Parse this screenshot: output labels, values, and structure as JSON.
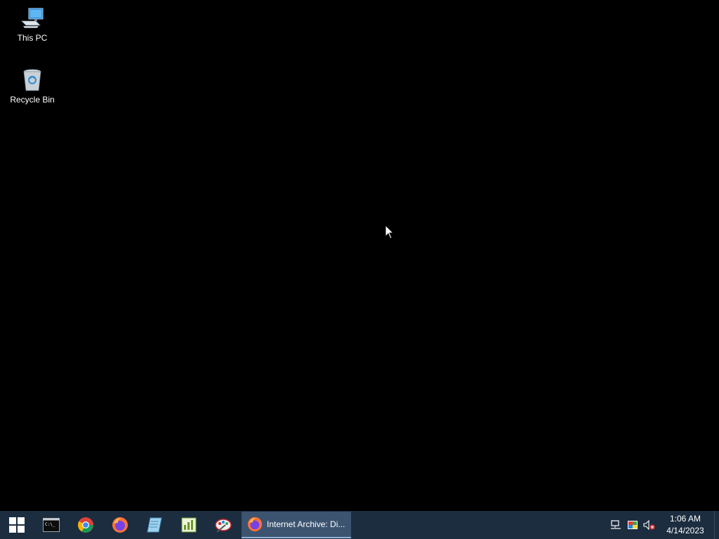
{
  "desktop": {
    "icons": [
      {
        "label": "This PC",
        "icon": "computer-icon"
      },
      {
        "label": "Recycle Bin",
        "icon": "recycle-bin-icon"
      }
    ]
  },
  "taskbar": {
    "start_icon": "windows-logo-icon",
    "pinned": [
      {
        "name": "command-prompt",
        "icon": "terminal-icon"
      },
      {
        "name": "google-chrome",
        "icon": "chrome-icon"
      },
      {
        "name": "firefox",
        "icon": "firefox-icon"
      },
      {
        "name": "notepad",
        "icon": "notepad-icon"
      },
      {
        "name": "spreadsheet-editor",
        "icon": "spreadsheet-icon"
      },
      {
        "name": "paint-tool",
        "icon": "paint-icon"
      }
    ],
    "active_window": {
      "title": "Internet Archive: Di...",
      "icon": "firefox-icon"
    },
    "tray": {
      "icons": [
        "network-icon",
        "display-icon",
        "volume-muted-icon"
      ],
      "time": "1:06 AM",
      "date": "4/14/2023"
    }
  },
  "colors": {
    "desktop_bg": "#000000",
    "taskbar_bg": "#1c2d40",
    "active_window_bg": "#3c5470"
  }
}
